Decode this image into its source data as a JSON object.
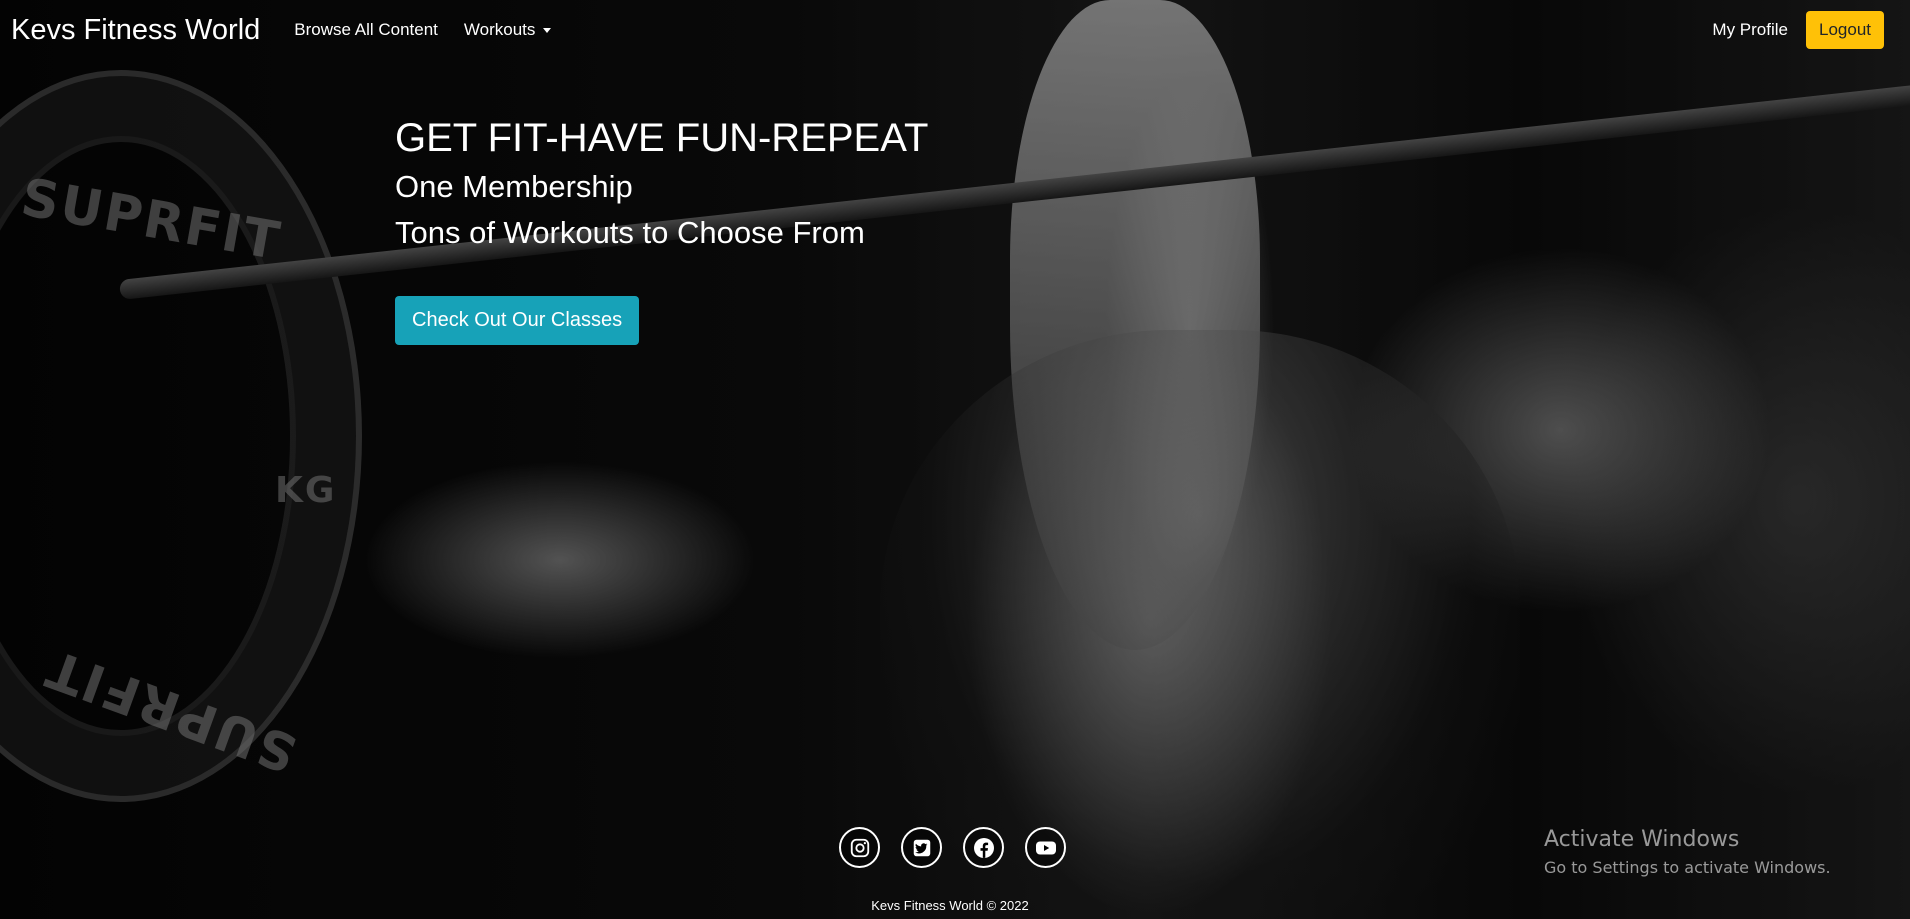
{
  "navbar": {
    "brand": "Kevs Fitness World",
    "browse_label": "Browse All Content",
    "workouts_label": "Workouts",
    "profile_label": "My Profile",
    "logout_label": "Logout"
  },
  "hero": {
    "title": "GET FIT-HAVE FUN-REPEAT",
    "line1": "One Membership",
    "line2": "Tons of Workouts to Choose From",
    "cta_label": "Check Out Our Classes",
    "background_plate_text_top": "SUPRFIT",
    "background_plate_text_bottom": "SUPRFIT",
    "background_plate_kg": "KG"
  },
  "social": [
    "instagram-icon",
    "twitter-icon",
    "facebook-icon",
    "youtube-icon"
  ],
  "footer": {
    "copyright": "Kevs Fitness World © 2022"
  },
  "watermark": {
    "title": "Activate Windows",
    "subtitle": "Go to Settings to activate Windows."
  },
  "colors": {
    "logout_bg": "#ffc107",
    "cta_bg": "#17a2b8"
  }
}
